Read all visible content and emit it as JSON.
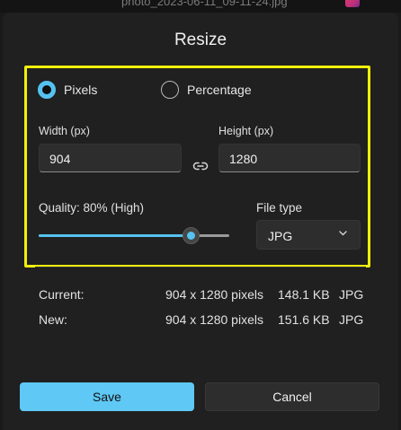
{
  "window": {
    "file_name": "photo_2023-06-11_09-11-24.jpg"
  },
  "dialog": {
    "title": "Resize",
    "mode_options": [
      {
        "label": "Pixels",
        "selected": true
      },
      {
        "label": "Percentage",
        "selected": false
      }
    ],
    "width": {
      "label": "Width  (px)",
      "value": "904"
    },
    "height": {
      "label": "Height  (px)",
      "value": "1280"
    },
    "aspect_lock_icon": "link-icon",
    "quality": {
      "label": "Quality: 80% (High)",
      "value": 0.8
    },
    "file_type": {
      "label": "File type",
      "selected": "JPG"
    },
    "info": {
      "current": {
        "label": "Current:",
        "dimensions": "904 x 1280 pixels",
        "size": "148.1 KB",
        "format": "JPG"
      },
      "new": {
        "label": "New:",
        "dimensions": "904 x 1280 pixels",
        "size": "151.6 KB",
        "format": "JPG"
      }
    },
    "buttons": {
      "save": "Save",
      "cancel": "Cancel"
    }
  },
  "colors": {
    "accent": "#56c2f0",
    "highlight_outline": "#f1f00b",
    "background": "#202020"
  }
}
